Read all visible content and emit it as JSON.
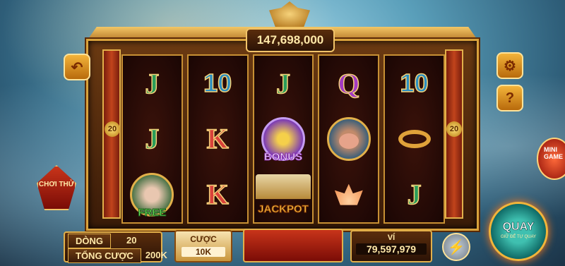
{
  "jackpot": {
    "amount": "147,698,000"
  },
  "reels": [
    [
      {
        "type": "letter",
        "label": "J",
        "cls": "J",
        "icon": "j-symbol"
      },
      {
        "type": "letter",
        "label": "J",
        "cls": "J",
        "icon": "j-symbol"
      },
      {
        "type": "free",
        "label": "FREE",
        "icon": "free-symbol"
      }
    ],
    [
      {
        "type": "letter",
        "label": "10",
        "cls": "ten",
        "icon": "ten-symbol"
      },
      {
        "type": "letter",
        "label": "K",
        "cls": "K",
        "icon": "k-symbol"
      },
      {
        "type": "letter",
        "label": "K",
        "cls": "K",
        "icon": "k-symbol"
      }
    ],
    [
      {
        "type": "letter",
        "label": "J",
        "cls": "J",
        "icon": "j-symbol"
      },
      {
        "type": "bonus",
        "label": "BONUS",
        "icon": "bonus-symbol"
      },
      {
        "type": "jackpot",
        "label": "JACKPOT",
        "icon": "jackpot-symbol"
      }
    ],
    [
      {
        "type": "letter",
        "label": "Q",
        "cls": "Q",
        "icon": "q-symbol"
      },
      {
        "type": "pig",
        "label": "",
        "icon": "pig-symbol"
      },
      {
        "type": "lotus",
        "label": "",
        "icon": "lotus-symbol"
      }
    ],
    [
      {
        "type": "letter",
        "label": "10",
        "cls": "ten",
        "icon": "ten-symbol"
      },
      {
        "type": "ring",
        "label": "",
        "icon": "golden-ring-symbol"
      },
      {
        "type": "letter",
        "label": "J",
        "cls": "J",
        "icon": "j-symbol"
      }
    ]
  ],
  "line_markers": {
    "left": "20",
    "right": "20"
  },
  "side": {
    "try_label": "CHƠI THỬ",
    "minigame_label": "MINI GAME"
  },
  "stats": {
    "lines_label": "DÒNG",
    "lines_value": "20",
    "total_bet_label": "TỔNG CƯỢC",
    "total_bet_value": "200K"
  },
  "bet": {
    "label": "CƯỢC",
    "value": "10K"
  },
  "wallet": {
    "label": "VÍ",
    "value": "79,597,979"
  },
  "spin": {
    "label": "QUAY",
    "sub": "GIỮ ĐỂ TỰ QUAY"
  },
  "icons": {
    "back": "back-arrow-icon",
    "settings": "gear-icon",
    "help": "question-icon",
    "turbo": "lightning-icon"
  }
}
